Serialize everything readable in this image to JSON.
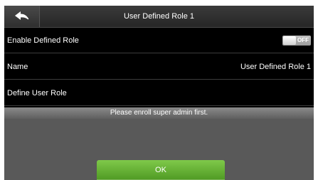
{
  "header": {
    "back_icon": "back-arrow-icon",
    "title": "User Defined Role 1"
  },
  "settings": {
    "enable_defined_role": {
      "label": "Enable Defined Role",
      "toggle_state": "OFF"
    },
    "name": {
      "label": "Name",
      "value": "User Defined Role 1"
    },
    "define_user_role": {
      "label": "Define User Role"
    }
  },
  "dialog": {
    "message": "Please enroll super admin first.",
    "ok_label": "OK"
  },
  "colors": {
    "background": "#000000",
    "dialog": "#595959",
    "ok_button": "#5fae30",
    "toggle": "#b0b0b0"
  }
}
